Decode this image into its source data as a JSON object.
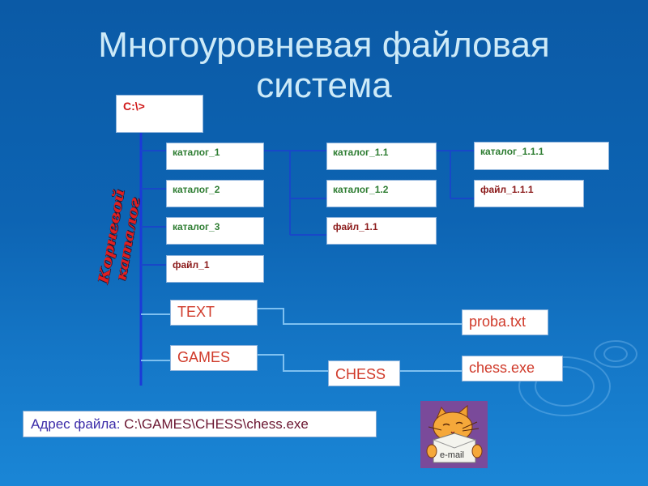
{
  "title": {
    "line1": "Многоуровневая файловая",
    "line2": "система"
  },
  "root": {
    "label": "C:\\>",
    "side_label": "Корневой каталог"
  },
  "level1": [
    {
      "label": "каталог_1",
      "type": "directory"
    },
    {
      "label": "каталог_2",
      "type": "directory"
    },
    {
      "label": "каталог_3",
      "type": "directory"
    },
    {
      "label": "файл_1",
      "type": "file"
    }
  ],
  "level2": [
    {
      "label": "каталог_1.1",
      "type": "directory"
    },
    {
      "label": "каталог_1.2",
      "type": "directory"
    },
    {
      "label": "файл_1.1",
      "type": "file"
    }
  ],
  "level3": [
    {
      "label": "каталог_1.1.1",
      "type": "directory"
    },
    {
      "label": "файл_1.1.1",
      "type": "file"
    }
  ],
  "example": {
    "text_dir": "TEXT",
    "games_dir": "GAMES",
    "chess_dir": "CHESS",
    "proba_file": "proba.txt",
    "chess_file": "chess.exe"
  },
  "address": {
    "label": "Адрес файла:",
    "value": "C:\\GAMES\\CHESS\\chess.exe"
  },
  "email_image": {
    "icon": "cat-email-icon",
    "text": "e-mail"
  },
  "colors": {
    "directory_text": "#2e7d32",
    "file_text": "#8b1a1a",
    "root_text": "#d01818",
    "example_text": "#d03a2a",
    "title_text": "#cdeaf8"
  }
}
